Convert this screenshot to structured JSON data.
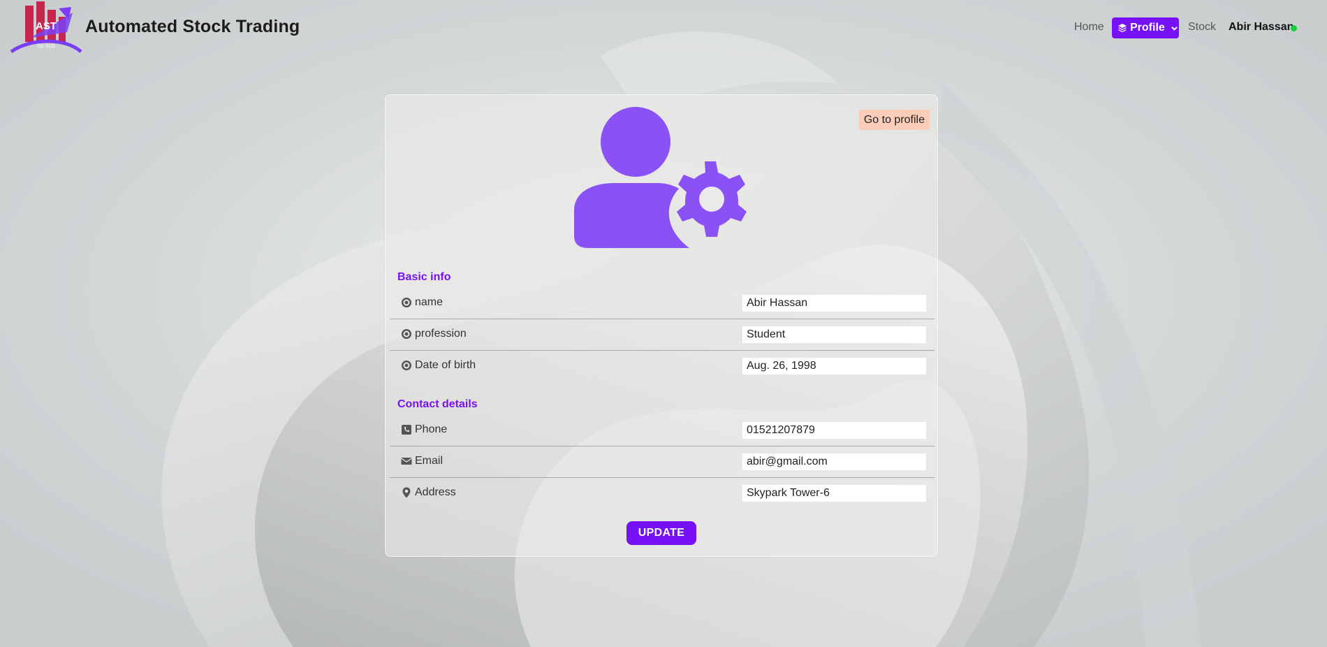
{
  "app": {
    "title": "Automated Stock Trading",
    "logo_text": "AST",
    "logo_sub": "Est. 2023"
  },
  "nav": {
    "home": "Home",
    "profile": "Profile",
    "stock": "Stock",
    "user": "Abir Hassan",
    "status_color": "#13d13a"
  },
  "colors": {
    "accent": "#7611f7",
    "go_profile_bg": "#f9cdb8"
  },
  "card": {
    "go_profile": "Go to profile",
    "avatar_icon": "user-gear-icon",
    "basic_info": {
      "heading": "Basic info",
      "rows": [
        {
          "icon": "dot-circle-icon",
          "label": "name",
          "value": "Abir Hassan"
        },
        {
          "icon": "dot-circle-icon",
          "label": "profession",
          "value": "Student"
        },
        {
          "icon": "dot-circle-icon",
          "label": "Date of birth",
          "value": "Aug. 26, 1998"
        }
      ]
    },
    "contact": {
      "heading": "Contact details",
      "rows": [
        {
          "icon": "phone-icon",
          "label": "Phone",
          "value": "01521207879"
        },
        {
          "icon": "envelope-icon",
          "label": "Email",
          "value": "abir@gmail.com"
        },
        {
          "icon": "map-marker-icon",
          "label": "Address",
          "value": "Skypark Tower-6"
        }
      ]
    },
    "update_button": "UPDATE"
  }
}
